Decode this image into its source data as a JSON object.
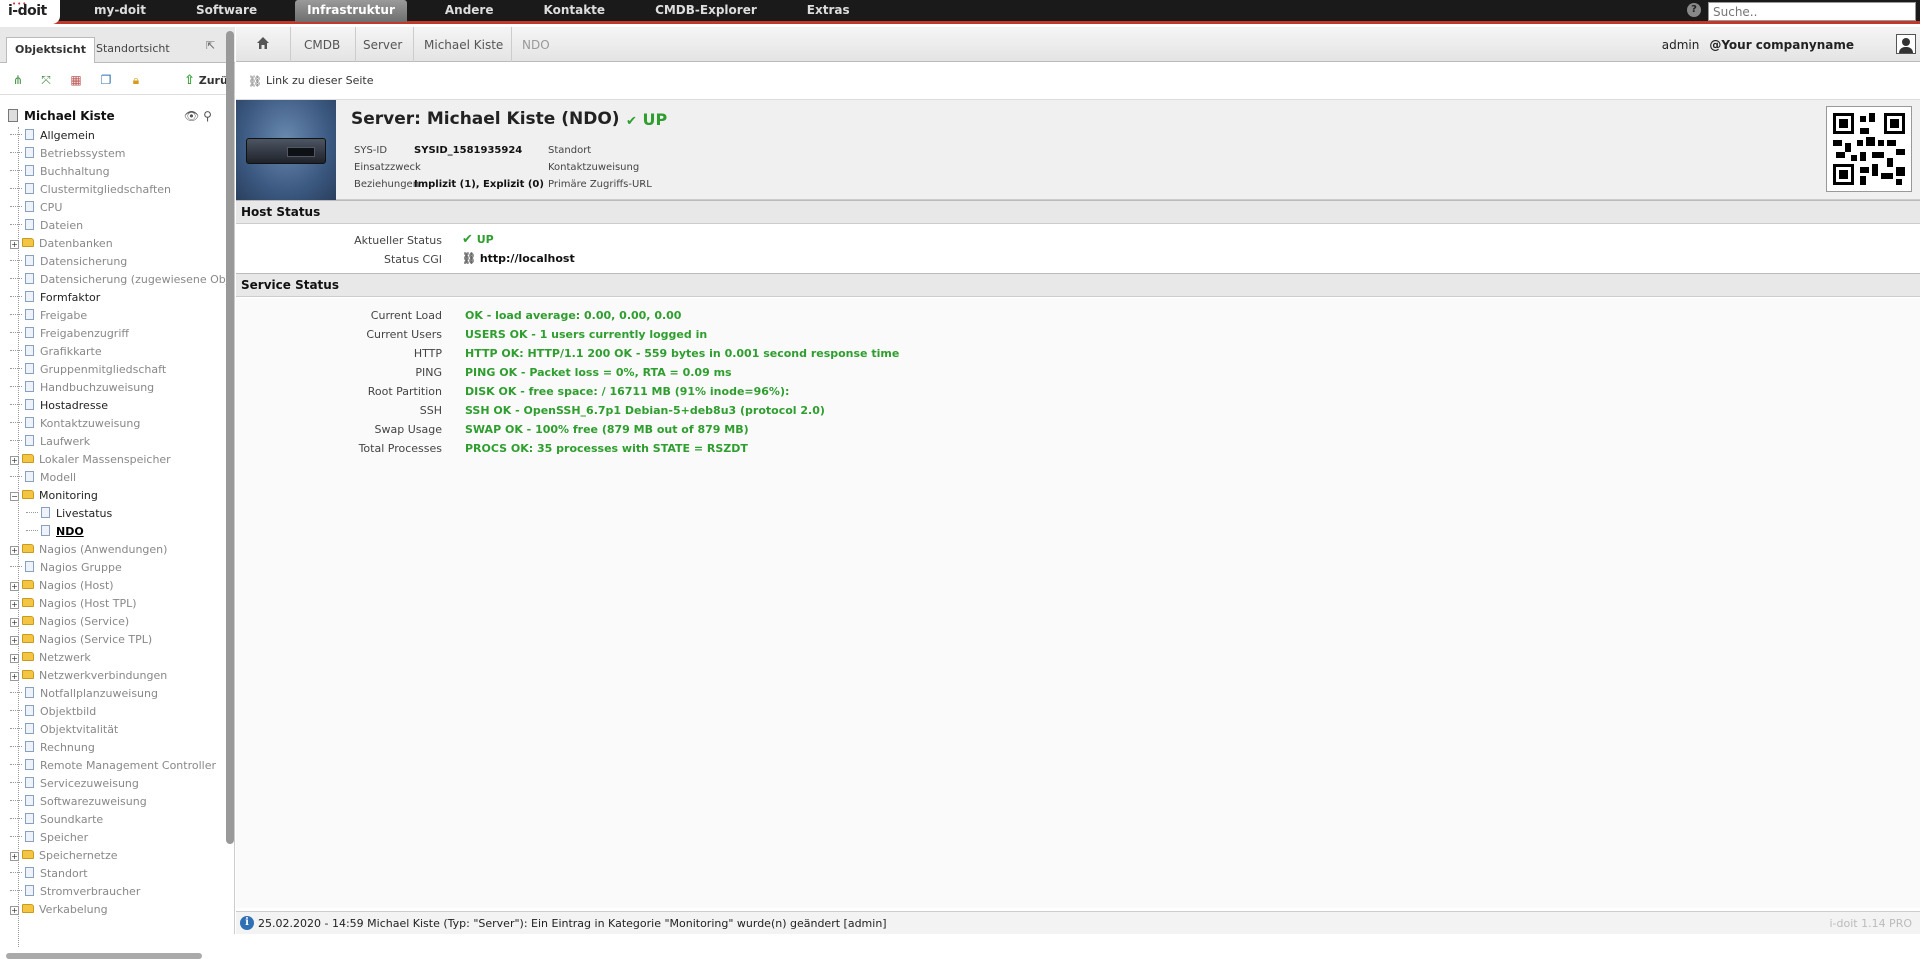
{
  "topbar": {
    "logo": "i-doit",
    "nav": [
      "my-doit",
      "Software",
      "Infrastruktur",
      "Andere",
      "Kontakte",
      "CMDB-Explorer",
      "Extras"
    ],
    "active_nav": "Infrastruktur",
    "search_placeholder": "Suche.."
  },
  "leftpanel": {
    "tab_object": "Objektsicht",
    "tab_location": "Standortsicht",
    "back_label": "Zurü",
    "tree_root": "Michael Kiste",
    "tree": [
      {
        "label": "Allgemein",
        "type": "doc",
        "dark": true
      },
      {
        "label": "Betriebssystem",
        "type": "doc"
      },
      {
        "label": "Buchhaltung",
        "type": "doc"
      },
      {
        "label": "Clustermitgliedschaften",
        "type": "doc"
      },
      {
        "label": "CPU",
        "type": "doc"
      },
      {
        "label": "Dateien",
        "type": "doc"
      },
      {
        "label": "Datenbanken",
        "type": "folder",
        "expandable": true
      },
      {
        "label": "Datensicherung",
        "type": "doc"
      },
      {
        "label": "Datensicherung (zugewiesene Objekte)",
        "type": "doc"
      },
      {
        "label": "Formfaktor",
        "type": "doc",
        "dark": true
      },
      {
        "label": "Freigabe",
        "type": "doc"
      },
      {
        "label": "Freigabenzugriff",
        "type": "doc"
      },
      {
        "label": "Grafikkarte",
        "type": "doc"
      },
      {
        "label": "Gruppenmitgliedschaft",
        "type": "doc"
      },
      {
        "label": "Handbuchzuweisung",
        "type": "doc"
      },
      {
        "label": "Hostadresse",
        "type": "doc",
        "dark": true
      },
      {
        "label": "Kontaktzuweisung",
        "type": "doc"
      },
      {
        "label": "Laufwerk",
        "type": "doc"
      },
      {
        "label": "Lokaler Massenspeicher",
        "type": "folder",
        "expandable": true
      },
      {
        "label": "Modell",
        "type": "doc"
      },
      {
        "label": "Monitoring",
        "type": "folder",
        "expanded": true,
        "dark": true
      },
      {
        "label": "Livestatus",
        "type": "doc",
        "sub": true,
        "dark": true
      },
      {
        "label": "NDO",
        "type": "doc",
        "sub": true,
        "current": true
      },
      {
        "label": "Nagios (Anwendungen)",
        "type": "folder",
        "expandable": true
      },
      {
        "label": "Nagios Gruppe",
        "type": "doc"
      },
      {
        "label": "Nagios (Host)",
        "type": "folder",
        "expandable": true
      },
      {
        "label": "Nagios (Host TPL)",
        "type": "folder",
        "expandable": true
      },
      {
        "label": "Nagios (Service)",
        "type": "folder",
        "expandable": true
      },
      {
        "label": "Nagios (Service TPL)",
        "type": "folder",
        "expandable": true
      },
      {
        "label": "Netzwerk",
        "type": "folder",
        "expandable": true
      },
      {
        "label": "Netzwerkverbindungen",
        "type": "folder",
        "expandable": true
      },
      {
        "label": "Notfallplanzuweisung",
        "type": "doc"
      },
      {
        "label": "Objektbild",
        "type": "doc"
      },
      {
        "label": "Objektvitalität",
        "type": "doc"
      },
      {
        "label": "Rechnung",
        "type": "doc"
      },
      {
        "label": "Remote Management Controller",
        "type": "doc"
      },
      {
        "label": "Servicezuweisung",
        "type": "doc"
      },
      {
        "label": "Softwarezuweisung",
        "type": "doc"
      },
      {
        "label": "Soundkarte",
        "type": "doc"
      },
      {
        "label": "Speicher",
        "type": "doc"
      },
      {
        "label": "Speichernetze",
        "type": "folder",
        "expandable": true
      },
      {
        "label": "Standort",
        "type": "doc"
      },
      {
        "label": "Stromverbraucher",
        "type": "doc"
      },
      {
        "label": "Verkabelung",
        "type": "folder",
        "expandable": true
      }
    ]
  },
  "breadcrumb": {
    "items": [
      "CMDB",
      "Server",
      "Michael Kiste",
      "NDO"
    ],
    "user": "admin",
    "company": "@Your companyname"
  },
  "linkbar": {
    "label": "Link zu dieser Seite"
  },
  "object": {
    "title": "Server: Michael Kiste (NDO)",
    "status": "UP",
    "sysid_label": "SYS-ID",
    "sysid_value": "SYSID_1581935924",
    "purpose_label": "Einsatzzweck",
    "relations_label": "Beziehungen",
    "relations_value": "Implizit (1), Explizit (0)",
    "location_label": "Standort",
    "contact_label": "Kontaktzuweisung",
    "url_label": "Primäre Zugriffs-URL",
    "url_value": "-"
  },
  "host_status": {
    "title": "Host Status",
    "current_label": "Aktueller Status",
    "current_value": "UP",
    "cgi_label": "Status CGI",
    "cgi_value": "http://localhost"
  },
  "service_status": {
    "title": "Service Status",
    "rows": [
      {
        "label": "Current Load",
        "value": "OK - load average: 0.00, 0.00, 0.00"
      },
      {
        "label": "Current Users",
        "value": "USERS OK - 1 users currently logged in"
      },
      {
        "label": "HTTP",
        "value": "HTTP OK: HTTP/1.1 200 OK - 559 bytes in 0.001 second response time"
      },
      {
        "label": "PING",
        "value": "PING OK - Packet loss = 0%, RTA = 0.09 ms"
      },
      {
        "label": "Root Partition",
        "value": "DISK OK - free space: / 16711 MB (91% inode=96%):"
      },
      {
        "label": "SSH",
        "value": "SSH OK - OpenSSH_6.7p1 Debian-5+deb8u3 (protocol 2.0)"
      },
      {
        "label": "Swap Usage",
        "value": "SWAP OK - 100% free (879 MB out of 879 MB)"
      },
      {
        "label": "Total Processes",
        "value": "PROCS OK: 35 processes with STATE = RSZDT"
      }
    ]
  },
  "statusbar": {
    "message": "25.02.2020 - 14:59 Michael Kiste (Typ: \"Server\"): Ein Eintrag in Kategorie \"Monitoring\" wurde(n) geändert [admin]",
    "version": "i-doit 1.14 PRO"
  }
}
